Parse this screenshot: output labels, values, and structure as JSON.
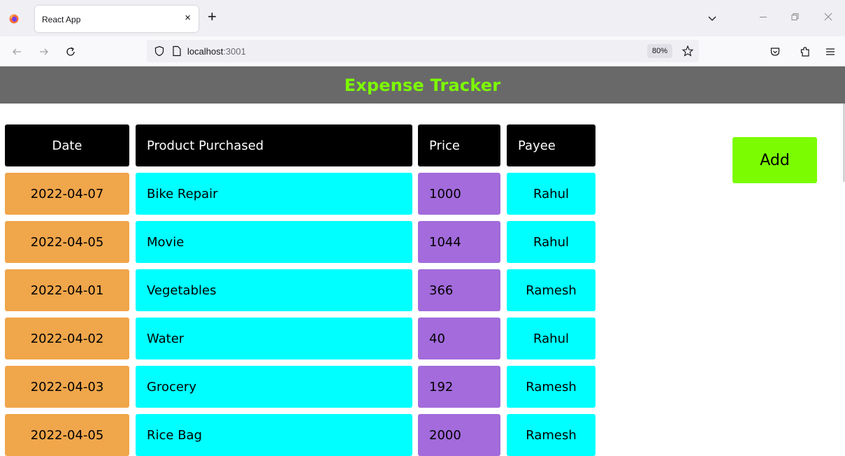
{
  "browser": {
    "tab_title": "React App",
    "tab_close": "×",
    "new_tab": "+",
    "url_host": "localhost",
    "url_port": ":3001",
    "zoom": "80%"
  },
  "app": {
    "title": "Expense Tracker",
    "add_label": "Add",
    "columns": [
      "Date",
      "Product Purchased",
      "Price",
      "Payee"
    ],
    "rows": [
      {
        "date": "2022-04-07",
        "product": "Bike Repair",
        "price": "1000",
        "payee": "Rahul"
      },
      {
        "date": "2022-04-05",
        "product": "Movie",
        "price": "1044",
        "payee": "Rahul"
      },
      {
        "date": "2022-04-01",
        "product": "Vegetables",
        "price": "366",
        "payee": "Ramesh"
      },
      {
        "date": "2022-04-02",
        "product": "Water",
        "price": "40",
        "payee": "Rahul"
      },
      {
        "date": "2022-04-03",
        "product": "Grocery",
        "price": "192",
        "payee": "Ramesh"
      },
      {
        "date": "2022-04-05",
        "product": "Rice Bag",
        "price": "2000",
        "payee": "Ramesh"
      }
    ]
  },
  "colors": {
    "header_bg": "#696969",
    "title": "#7cfc00",
    "date_cell": "#f0a64b",
    "product_cell": "#00ffff",
    "price_cell": "#a36bdc",
    "payee_cell": "#00ffff",
    "add_button": "#7cfc00"
  },
  "icons": [
    "firefox-logo-icon",
    "close-icon",
    "plus-icon",
    "chevron-down-icon",
    "minimize-icon",
    "restore-icon",
    "window-close-icon",
    "back-arrow-icon",
    "forward-arrow-icon",
    "reload-icon",
    "shield-icon",
    "page-icon",
    "star-icon",
    "pocket-icon",
    "extensions-icon",
    "menu-icon"
  ]
}
